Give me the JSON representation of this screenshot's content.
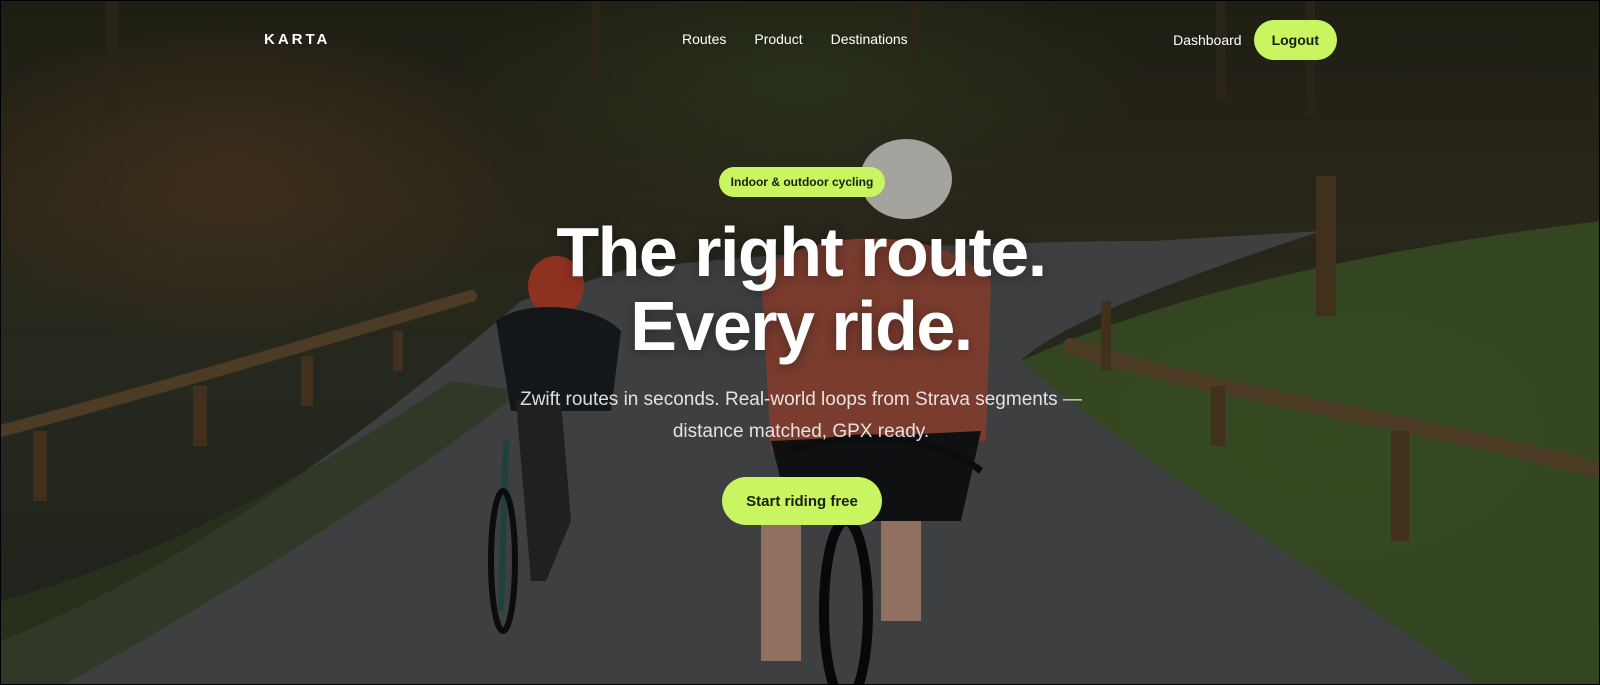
{
  "brand": {
    "logo": "KARTA"
  },
  "nav": {
    "links": [
      "Routes",
      "Product",
      "Destinations"
    ],
    "dashboard": "Dashboard",
    "logout": "Logout"
  },
  "hero": {
    "badge": "Indoor & outdoor cycling",
    "headline_line1": "The right route.",
    "headline_line2": "Every ride.",
    "sub_line1": "Zwift routes in seconds. Real-world loops from Strava segments —",
    "sub_line2": "distance matched, GPX ready.",
    "cta": "Start riding free",
    "background_image": "cyclists-descending-forest-road"
  },
  "colors": {
    "accent": "#c8f560",
    "accent_text": "#1b1f10"
  }
}
